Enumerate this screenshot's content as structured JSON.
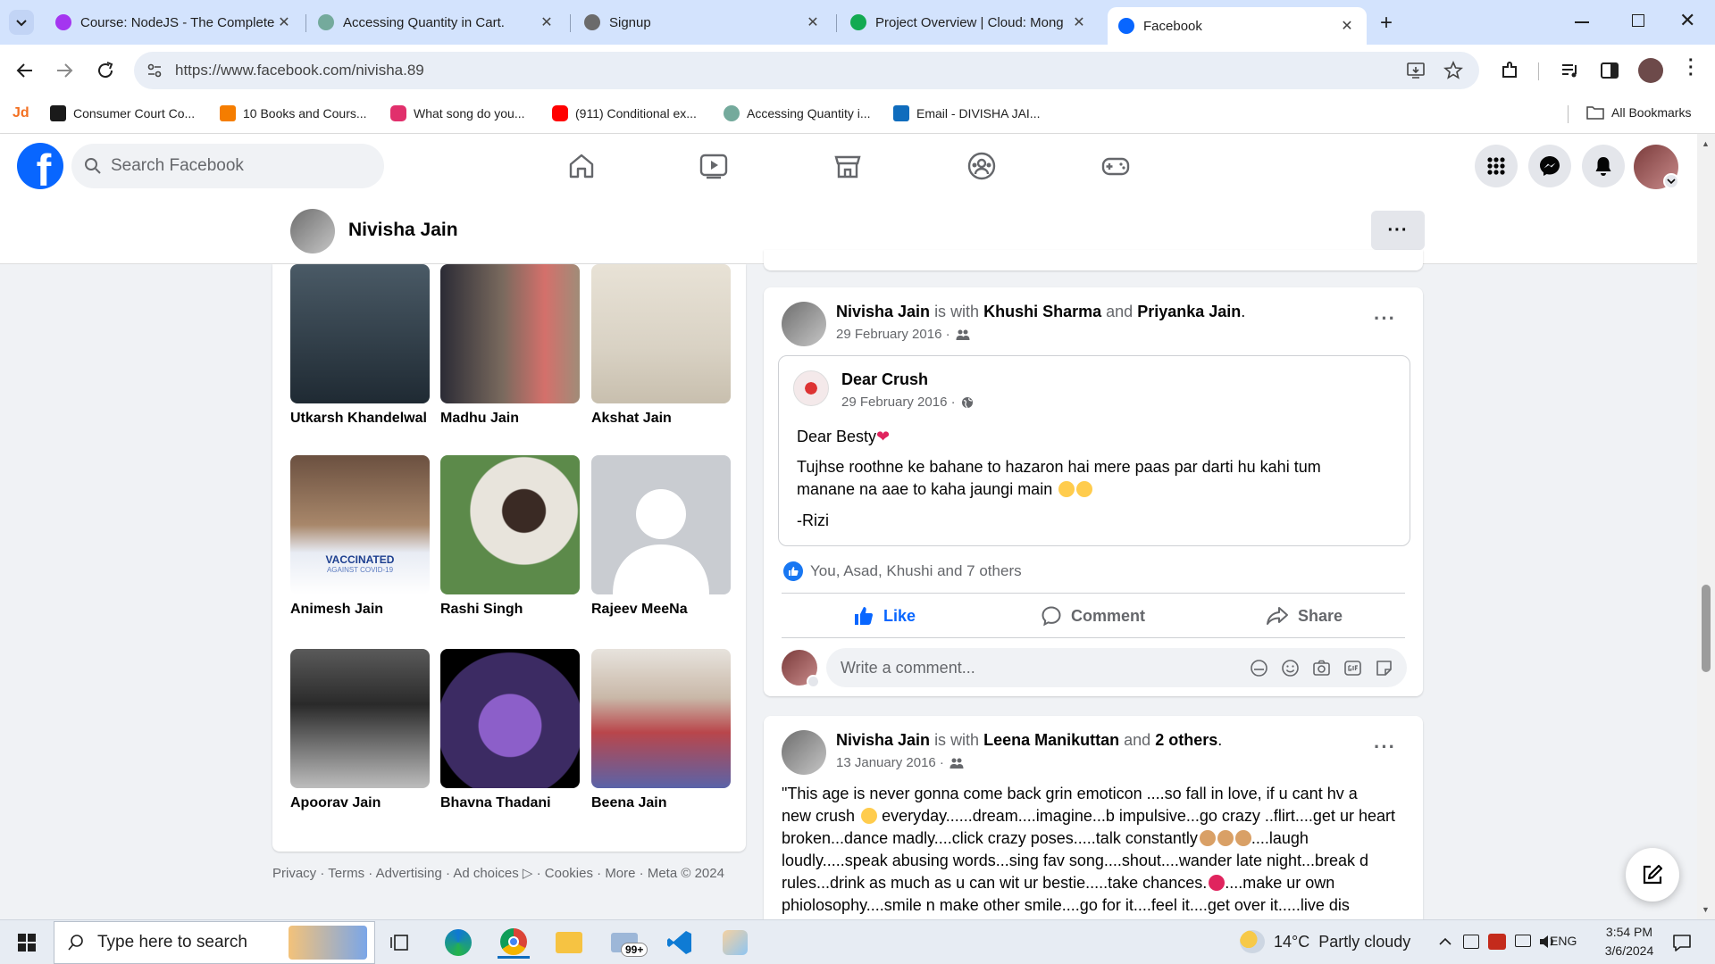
{
  "browser": {
    "tabs": [
      {
        "title": "Course: NodeJS - The Complete",
        "color": "#a435f0"
      },
      {
        "title": "Accessing Quantity in Cart.",
        "color": "#74aa9c"
      },
      {
        "title": "Signup",
        "color": "#6b6b6b"
      },
      {
        "title": "Project Overview | Cloud: Mong",
        "color": "#13aa52"
      },
      {
        "title": "Facebook",
        "color": "#0866ff"
      }
    ],
    "url": "https://www.facebook.com/nivisha.89",
    "bookmarks": [
      {
        "label": "",
        "color": "#f37021"
      },
      {
        "label": "Consumer Court Co...",
        "color": "#1a1a1a"
      },
      {
        "label": "10 Books and Cours...",
        "color": "#f57d00"
      },
      {
        "label": "What song do you...",
        "color": "#e1306c"
      },
      {
        "label": "(911) Conditional ex...",
        "color": "#ff0000"
      },
      {
        "label": "Accessing Quantity i...",
        "color": "#74aa9c"
      },
      {
        "label": "Email - DIVISHA JAI...",
        "color": "#0f6cbd"
      }
    ],
    "bookmarks_logo": "Jd",
    "all_bookmarks": "All Bookmarks"
  },
  "facebook": {
    "search_placeholder": "Search Facebook",
    "profile_name": "Nivisha Jain",
    "friends": [
      {
        "name": "Utkarsh Khandelwal",
        "color": "#2f3b45"
      },
      {
        "name": "Madhu Jain",
        "color": "#7a6a5e"
      },
      {
        "name": "Akshat Jain",
        "color": "#d9d2c4"
      },
      {
        "name": "Animesh Jain",
        "color": "#8d7b6a"
      },
      {
        "name": "Rashi Singh",
        "color": "#5c8a4a"
      },
      {
        "name": "Rajeev MeeNa",
        "color": "#c9ccd1"
      },
      {
        "name": "Apoorav Jain",
        "color": "#3d3d3d"
      },
      {
        "name": "Bhavna Thadani",
        "color": "#3c2b63"
      },
      {
        "name": "Beena Jain",
        "color": "#b9464b"
      }
    ],
    "vaccinated_badge": "VACCINATED",
    "vaccinated_sub": "AGAINST COVID-19",
    "footer_links": [
      "Privacy",
      "Terms",
      "Advertising",
      "Ad choices",
      "Cookies",
      "More",
      "Meta © 2024"
    ],
    "post1": {
      "author": "Nivisha Jain",
      "with_text": "is with",
      "tag1": "Khushi Sharma",
      "and_text": "and",
      "tag2": "Priyanka Jain",
      "date": "29 February 2016 ·",
      "shared": {
        "page": "Dear Crush",
        "date": "29 February 2016 ·",
        "line1": "Dear Besty",
        "line2": "Tujhse roothne ke bahane to hazaron hai mere  paas par darti hu kahi tum manane na aae to kaha jaungi main",
        "line3": "-Rizi"
      },
      "reactions": "You, Asad, Khushi and 7 others",
      "like": "Like",
      "comment": "Comment",
      "share": "Share",
      "comment_placeholder": "Write a comment..."
    },
    "post2": {
      "author": "Nivisha Jain",
      "with_text": "is with",
      "tag1": "Leena Manikuttan",
      "and_text": "and",
      "tag2": "2 others",
      "date": "13 January 2016 ·",
      "text": [
        "\"This age is never gonna come back grin emoticon ....so fall in love, if u cant hv a",
        "new crush",
        "everyday......dream....imagine...b impulsive...go crazy ..flirt....get ur heart",
        "broken...dance madly....click crazy poses.....talk constantly",
        "....laugh",
        "loudly.....speak abusing words...sing fav song....shout....wander late night...break d",
        "rules...drink as much as u can wit ur bestie.....take chances.",
        "....make ur own",
        "phiolosophy....smile n make other smile....go for it....feel it....get over it.....live dis"
      ]
    }
  },
  "taskbar": {
    "search_placeholder": "Type here to search",
    "mail_badge": "99+",
    "temperature": "14°C",
    "weather": "Partly cloudy",
    "language": "ENG",
    "time": "3:54 PM",
    "date": "3/6/2024"
  }
}
